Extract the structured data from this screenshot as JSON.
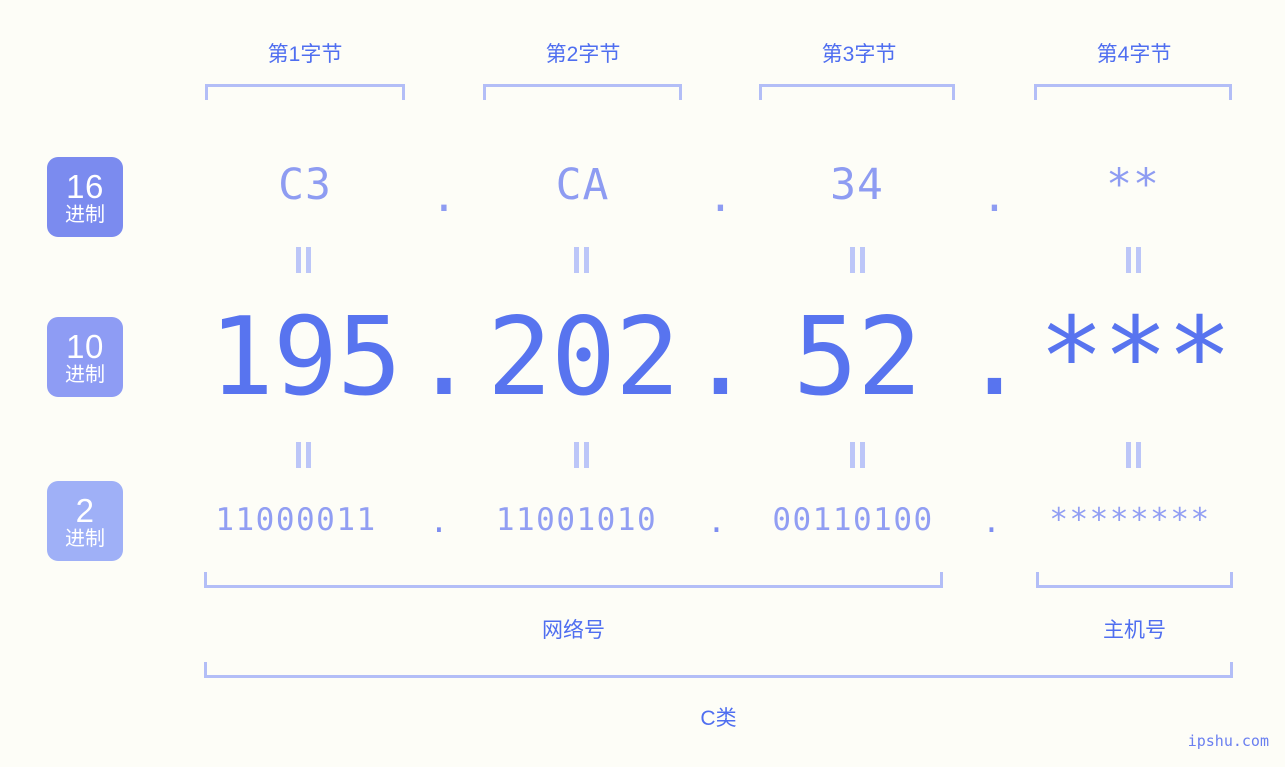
{
  "meta": {
    "watermark": "ipshu.com",
    "background_color": "#fdfdf7",
    "accent_color": "#5874ef",
    "accent_light": "#8e9cf2",
    "bracket_color": "#b3bef7"
  },
  "byte_headers": [
    {
      "label": "第1字节"
    },
    {
      "label": "第2字节"
    },
    {
      "label": "第3字节"
    },
    {
      "label": "第4字节"
    }
  ],
  "bases": [
    {
      "num": "16",
      "unit": "进制",
      "color": "#7b8bef"
    },
    {
      "num": "10",
      "unit": "进制",
      "color": "#8e9cf4"
    },
    {
      "num": "2",
      "unit": "进制",
      "color": "#9fb0f7"
    }
  ],
  "rows": {
    "hex": {
      "base_label": "16进制",
      "values": [
        "C3",
        "CA",
        "34",
        "**"
      ],
      "separator": "."
    },
    "decimal": {
      "base_label": "10进制",
      "values": [
        "195",
        "202",
        "52",
        "***"
      ],
      "separator": "."
    },
    "binary": {
      "base_label": "2进制",
      "values": [
        "11000011",
        "11001010",
        "00110100",
        "********"
      ],
      "separator": "."
    }
  },
  "equals_marker": "=",
  "sections": [
    {
      "label": "网络号"
    },
    {
      "label": "主机号"
    }
  ],
  "class": {
    "label": "C类"
  },
  "ip": {
    "hex": "C3.CA.34.**",
    "decimal": "195.202.52.***",
    "binary": "11000011.11001010.00110100.********"
  }
}
